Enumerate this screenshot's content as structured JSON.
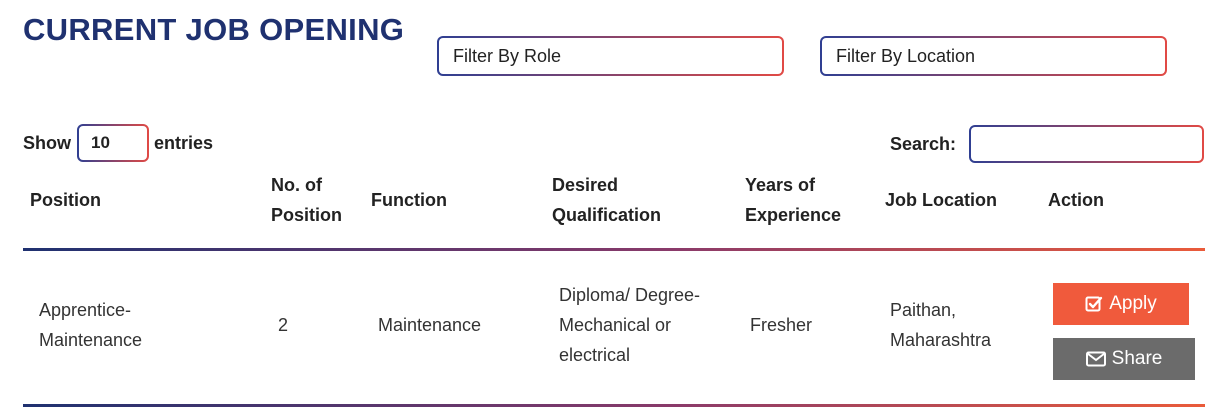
{
  "page": {
    "title": "CURRENT JOB OPENING"
  },
  "filters": {
    "role_placeholder": "Filter By Role",
    "location_placeholder": "Filter By Location"
  },
  "table_controls": {
    "show_label": "Show",
    "entries_value": "10",
    "entries_label": "entries",
    "search_label": "Search:",
    "search_value": ""
  },
  "table": {
    "headers": {
      "position": "Position",
      "no_of_position_l1": "No. of",
      "no_of_position_l2": "Position",
      "function": "Function",
      "qualification_l1": "Desired",
      "qualification_l2": "Qualification",
      "experience_l1": "Years of",
      "experience_l2": "Experience",
      "location": "Job Location",
      "action": "Action"
    },
    "rows": [
      {
        "position_l1": "Apprentice-",
        "position_l2": "Maintenance",
        "no_of_position": "2",
        "function": "Maintenance",
        "qualification_l1": "Diploma/ Degree-",
        "qualification_l2": "Mechanical or",
        "qualification_l3": "electrical",
        "experience": "Fresher",
        "location_l1": "Paithan,",
        "location_l2": "Maharashtra",
        "apply_label": "Apply",
        "share_label": "Share"
      }
    ]
  },
  "colors": {
    "title": "#1f3170",
    "apply": "#f05a3c",
    "share": "#6b6b6b",
    "border_start": "#2f3f92",
    "border_end": "#e14a45"
  },
  "icons": {
    "apply": "check-square-icon",
    "share": "envelope-icon"
  }
}
